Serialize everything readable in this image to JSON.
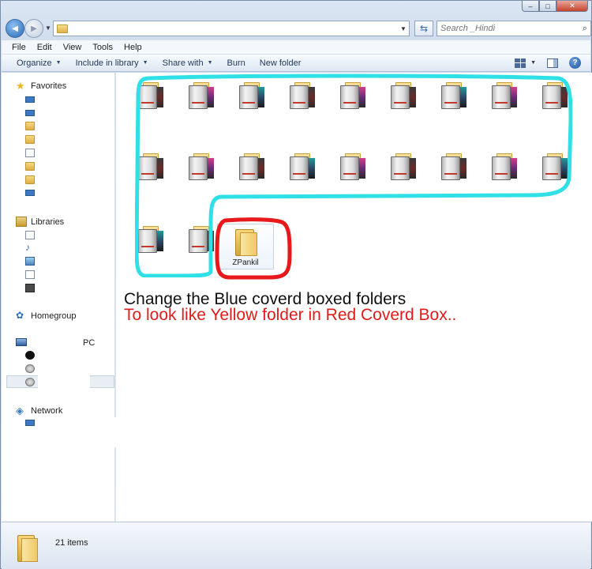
{
  "window": {
    "caption_min": "–",
    "caption_max": "□",
    "caption_close": "✕"
  },
  "address": {
    "back_glyph": "◀",
    "forward_glyph": "▶",
    "refresh_glyph": "⇆",
    "search_placeholder": "Search _Hindi",
    "search_glyph": "⌕"
  },
  "menu": {
    "items": [
      "File",
      "Edit",
      "View",
      "Tools",
      "Help"
    ]
  },
  "toolbar": {
    "organize": "Organize",
    "include_in_library": "Include in library",
    "share_with": "Share with",
    "burn": "Burn",
    "new_folder": "New folder",
    "help": "?"
  },
  "nav": {
    "favorites": "Favorites",
    "libraries": "Libraries",
    "homegroup": "Homegroup",
    "computer_suffix": "PC",
    "network": "Network"
  },
  "content": {
    "selected_folder_name": "ZPankil",
    "annotation_line1": "Change the Blue coverd boxed folders",
    "annotation_line2": "To look like Yellow folder in Red Coverd Box.."
  },
  "status": {
    "item_count": "21 items"
  },
  "colors": {
    "annotation_blue": "#2fe0e6",
    "annotation_red": "#e8191b",
    "annotation_red_text": "#e01b1b"
  }
}
